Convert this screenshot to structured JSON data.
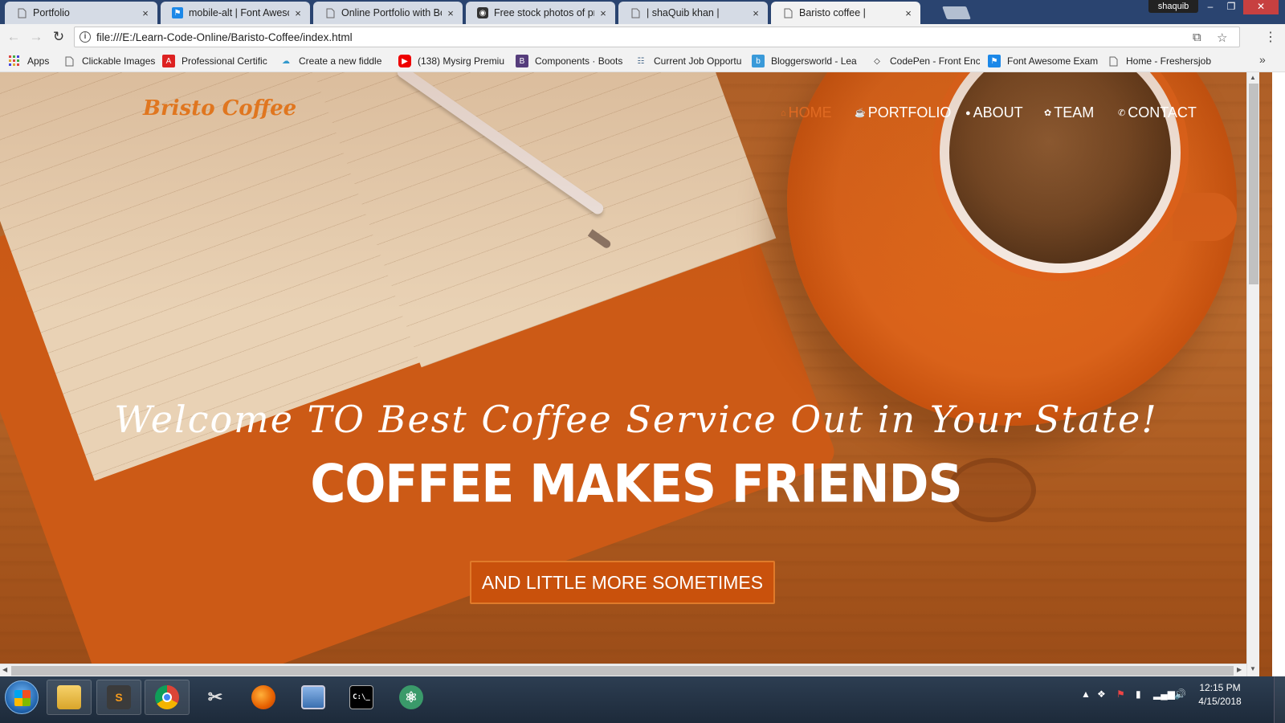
{
  "browser": {
    "tabs": [
      {
        "title": "Portfolio",
        "icon": "page-icon"
      },
      {
        "title": "mobile-alt | Font Awesom",
        "icon": "font-awesome-flag-icon"
      },
      {
        "title": "Online Portfolio with Boo",
        "icon": "page-icon"
      },
      {
        "title": "Free stock photos of proj",
        "icon": "camera-icon"
      },
      {
        "title": "| shaQuib khan |",
        "icon": "page-icon"
      },
      {
        "title": "Baristo coffee |",
        "icon": "page-icon"
      }
    ],
    "close_glyph": "×",
    "user_name": "shaquib",
    "window_controls": {
      "minimize": "–",
      "maximize": "❐",
      "close": "✕"
    },
    "url": "file:///E:/Learn-Code-Online/Baristo-Coffee/index.html",
    "bookmarks": [
      {
        "label": "Apps",
        "icon": "apps-grid-icon"
      },
      {
        "label": "Clickable Images",
        "icon": "page-icon"
      },
      {
        "label": "Professional Certific",
        "icon": "acrobat-icon"
      },
      {
        "label": "Create a new fiddle",
        "icon": "cloud-icon"
      },
      {
        "label": "(138) Mysirg Premiu",
        "icon": "youtube-icon"
      },
      {
        "label": "Components · Boots",
        "icon": "bootstrap-icon"
      },
      {
        "label": "Current Job Opportu",
        "icon": "users-icon"
      },
      {
        "label": "Bloggersworld - Lea",
        "icon": "blog-icon"
      },
      {
        "label": "CodePen - Front Enc",
        "icon": "codepen-icon"
      },
      {
        "label": "Font Awesome Exam",
        "icon": "font-awesome-flag-icon"
      },
      {
        "label": "Home - Freshersjob",
        "icon": "page-icon"
      }
    ],
    "more_glyph": "»"
  },
  "site": {
    "brand": "Bristo Coffee",
    "nav": [
      {
        "label": "HOME",
        "icon": "home-icon",
        "glyph": "⌂",
        "active": true
      },
      {
        "label": "PORTFOLIO",
        "icon": "coffee-icon",
        "glyph": "☕",
        "active": false
      },
      {
        "label": "ABOUT",
        "icon": "user-icon",
        "glyph": "●",
        "active": false
      },
      {
        "label": "TEAM",
        "icon": "team-icon",
        "glyph": "✿",
        "active": false
      },
      {
        "label": "CONTACT",
        "icon": "phone-icon",
        "glyph": "✆",
        "active": false
      }
    ],
    "hero": {
      "tagline": "Welcome TO Best Coffee Service Out in Your State!",
      "title": "COFFEE MAKES FRIENDS",
      "button": "AND LITTLE MORE SOMETIMES"
    },
    "colors": {
      "accent": "#e0761f",
      "button": "#c9510c"
    }
  },
  "taskbar": {
    "apps": [
      {
        "name": "windows-explorer",
        "icon": "folder-icon"
      },
      {
        "name": "sublime-text",
        "icon": "sublime-icon"
      },
      {
        "name": "chrome",
        "icon": "chrome-icon"
      },
      {
        "name": "snipping-tool",
        "icon": "scissors-icon"
      },
      {
        "name": "firefox",
        "icon": "firefox-icon"
      },
      {
        "name": "remote-desktop",
        "icon": "monitor-icon"
      },
      {
        "name": "command-prompt",
        "icon": "terminal-icon"
      },
      {
        "name": "atom",
        "icon": "atom-icon"
      }
    ],
    "cmd_glyph": "C:\\_",
    "time": "12:15 PM",
    "date": "4/15/2018"
  }
}
